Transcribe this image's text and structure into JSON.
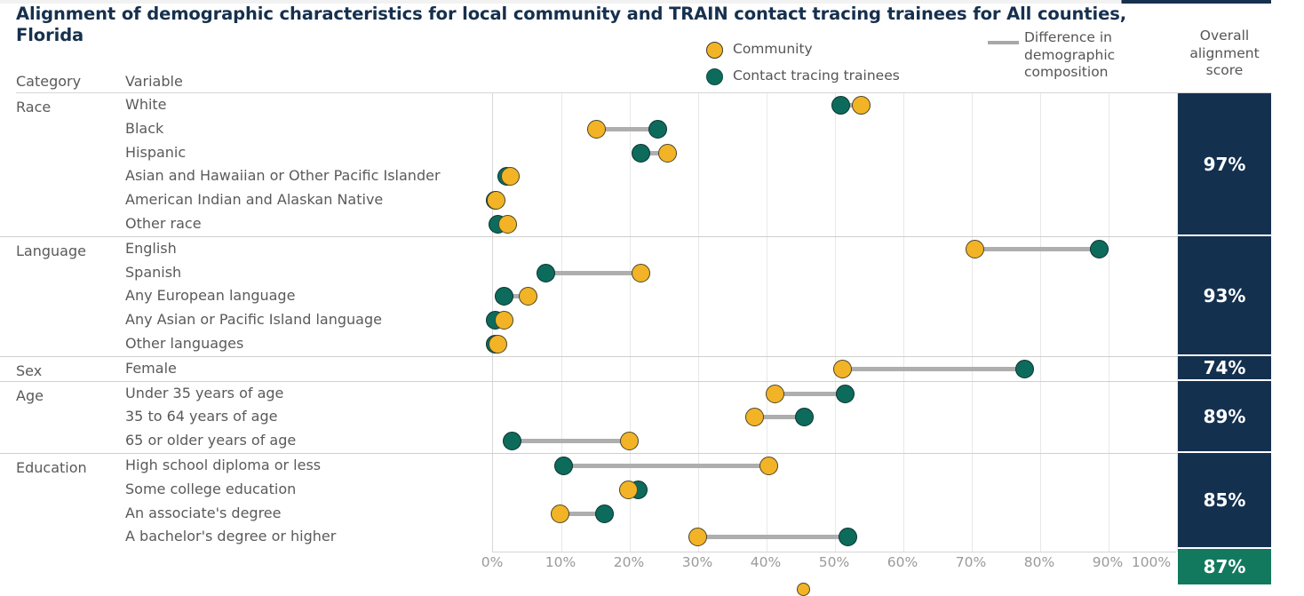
{
  "title": "Alignment of demographic characteristics for local community and TRAIN contact tracing trainees for All counties, Florida",
  "legend": {
    "community_label": "Community",
    "trainee_label": "Contact tracing trainees",
    "difference_label": "Difference in demographic composition",
    "community_color": "#f2b426",
    "trainee_color": "#0d6b5c",
    "line_color": "#aeaeae"
  },
  "columns": {
    "category": "Category",
    "variable": "Variable",
    "overall_score": "Overall alignment score"
  },
  "colors": {
    "title": "#16304e",
    "score_cell": "#14304f",
    "total_cell": "#12795f",
    "gridline": "#e8e8e8"
  },
  "axis": {
    "ticks": [
      "0%",
      "10%",
      "20%",
      "30%",
      "40%",
      "50%",
      "60%",
      "70%",
      "80%",
      "90%",
      "100%"
    ]
  },
  "chart_data": {
    "type": "scatter",
    "title": "Alignment of demographic characteristics for local community and TRAIN contact tracing trainees for All counties, Florida",
    "xlabel": "",
    "ylabel": "",
    "xlim": [
      0,
      100
    ],
    "x_tick_labels": [
      "0%",
      "10%",
      "20%",
      "30%",
      "40%",
      "50%",
      "60%",
      "70%",
      "80%",
      "90%",
      "100%"
    ],
    "grid": true,
    "legend_position": "top",
    "series": [
      {
        "name": "Community",
        "color": "#f2b426"
      },
      {
        "name": "Contact tracing trainees",
        "color": "#0d6b5c"
      }
    ],
    "groups": [
      {
        "category": "Race",
        "alignment_score": "97%",
        "rows": [
          {
            "variable": "White",
            "community": 53.9,
            "trainee": 51.0
          },
          {
            "variable": "Black",
            "community": 15.3,
            "trainee": 24.2
          },
          {
            "variable": "Hispanic",
            "community": 25.6,
            "trainee": 21.7
          },
          {
            "variable": "Asian and Hawaiian or Other Pacific Islander",
            "community": 2.6,
            "trainee": 2.1
          },
          {
            "variable": "American Indian and Alaskan Native",
            "community": 0.6,
            "trainee": 0.4
          },
          {
            "variable": "Other race",
            "community": 2.3,
            "trainee": 0.9
          }
        ]
      },
      {
        "category": "Language",
        "alignment_score": "93%",
        "rows": [
          {
            "variable": "English",
            "community": 70.6,
            "trainee": 88.8
          },
          {
            "variable": "Spanish",
            "community": 21.8,
            "trainee": 7.8
          },
          {
            "variable": "Any European language",
            "community": 5.2,
            "trainee": 1.8
          },
          {
            "variable": "Any Asian or Pacific Island language",
            "community": 1.7,
            "trainee": 0.5
          },
          {
            "variable": "Other languages",
            "community": 0.9,
            "trainee": 0.4
          }
        ]
      },
      {
        "category": "Sex",
        "alignment_score": "74%",
        "rows": [
          {
            "variable": "Female",
            "community": 51.2,
            "trainee": 77.8
          }
        ]
      },
      {
        "category": "Age",
        "alignment_score": "89%",
        "rows": [
          {
            "variable": "Under 35 years of age",
            "community": 41.4,
            "trainee": 51.6
          },
          {
            "variable": "35 to 64 years of age",
            "community": 38.4,
            "trainee": 45.7
          },
          {
            "variable": "65 or older years of age",
            "community": 20.0,
            "trainee": 2.9
          }
        ]
      },
      {
        "category": "Education",
        "alignment_score": "85%",
        "rows": [
          {
            "variable": "High school diploma or less",
            "community": 40.5,
            "trainee": 10.5
          },
          {
            "variable": "Some college education",
            "community": 19.9,
            "trainee": 21.4
          },
          {
            "variable": "An associate's degree",
            "community": 9.9,
            "trainee": 16.4
          },
          {
            "variable": "A bachelor's degree or higher",
            "community": 30.1,
            "trainee": 52.0
          }
        ]
      }
    ],
    "overall_total": {
      "label": "Overall",
      "value": "87%"
    }
  }
}
